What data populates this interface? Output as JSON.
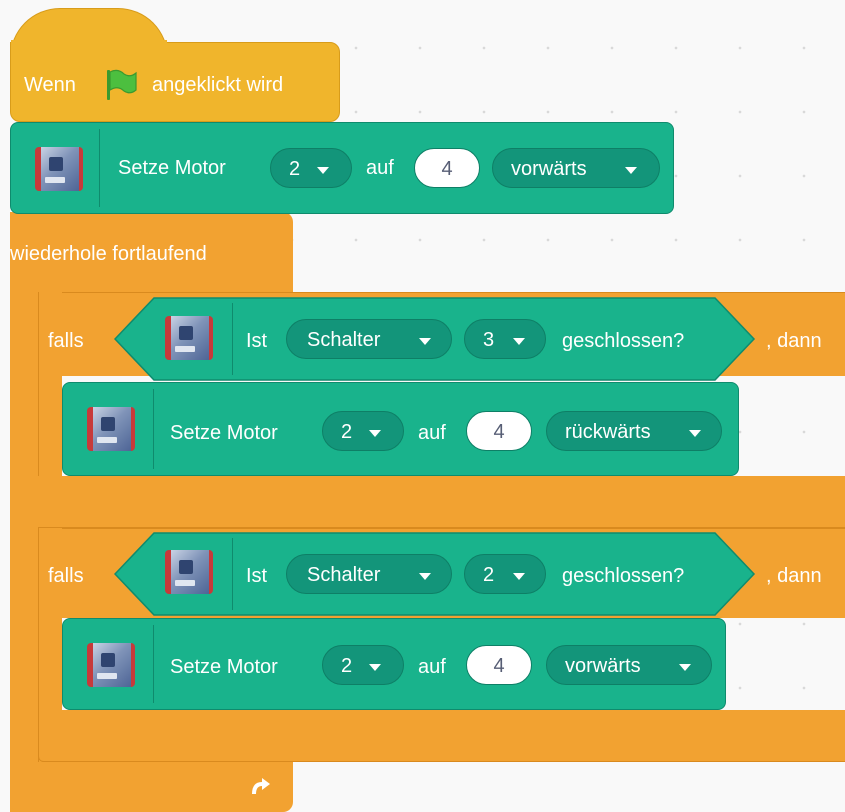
{
  "hat": {
    "prefix": "Wenn",
    "suffix": "angeklickt wird",
    "flag_icon": "green-flag-icon"
  },
  "motor1": {
    "label": "Setze Motor",
    "motor": "2",
    "on_label": "auf",
    "speed": "4",
    "direction": "vorwärts"
  },
  "loop": {
    "label": "wiederhole fortlaufend",
    "loop_icon": "loop-arrow-icon"
  },
  "if1": {
    "falls": "falls",
    "ist": "Ist",
    "sensor": "Schalter",
    "port": "3",
    "state": "geschlossen?",
    "dann": ", dann"
  },
  "motor2": {
    "label": "Setze Motor",
    "motor": "2",
    "on_label": "auf",
    "speed": "4",
    "direction": "rückwärts"
  },
  "if2": {
    "falls": "falls",
    "ist": "Ist",
    "sensor": "Schalter",
    "port": "2",
    "state": "geschlossen?",
    "dann": ", dann"
  },
  "motor3": {
    "label": "Setze Motor",
    "motor": "2",
    "on_label": "auf",
    "speed": "4",
    "direction": "vorwärts"
  },
  "colors": {
    "event": "#f0b52c",
    "control": "#f2a231",
    "extension": "#19b38c"
  }
}
